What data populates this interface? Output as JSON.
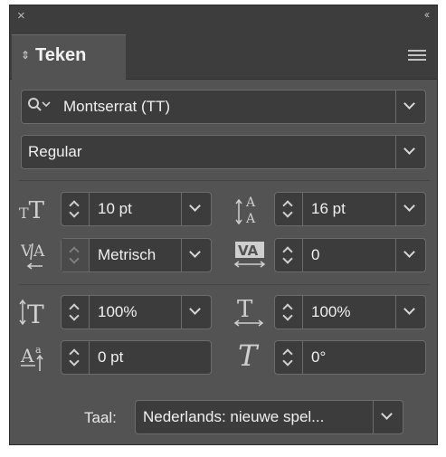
{
  "panel": {
    "close_glyph": "×",
    "collapse_glyph": "‹‹",
    "tab_label": "Teken",
    "tab_arrows": "⇕"
  },
  "font_family": {
    "value": "Montserrat (TT)"
  },
  "font_style": {
    "value": "Regular"
  },
  "fields": {
    "font_size": "10 pt",
    "leading": "16 pt",
    "kerning": "Metrisch",
    "tracking": "0",
    "vertical_scale": "100%",
    "horizontal_scale": "100%",
    "baseline_shift": "0 pt",
    "skew": "0°"
  },
  "language": {
    "label": "Taal:",
    "value": "Nederlands: nieuwe spel..."
  },
  "icons": {
    "font_size": "font-size-icon",
    "leading": "leading-icon",
    "kerning": "kerning-icon",
    "tracking": "tracking-icon",
    "vertical_scale": "vertical-scale-icon",
    "horizontal_scale": "horizontal-scale-icon",
    "baseline_shift": "baseline-shift-icon",
    "skew": "skew-icon"
  },
  "colors": {
    "panel_bg": "#535353",
    "field_bg": "#3c3c3c",
    "border": "#6c6c6c"
  }
}
